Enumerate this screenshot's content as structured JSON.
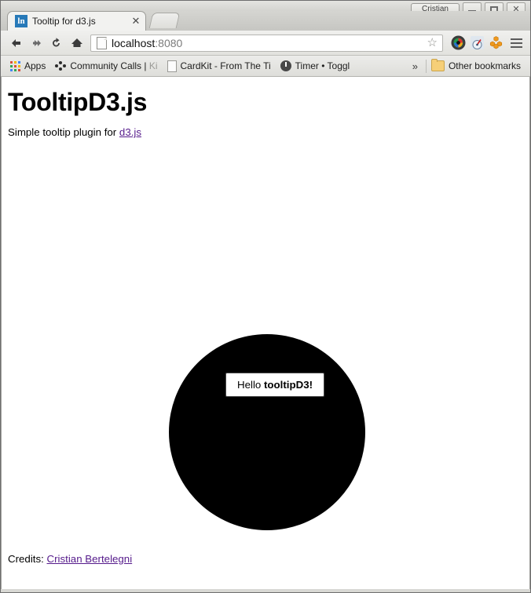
{
  "window": {
    "profile_label": "Cristian",
    "minimize_label": "–",
    "maximize_label": "□",
    "close_label": "✕"
  },
  "tabs": [
    {
      "favicon_text": "ln",
      "title": "Tooltip for d3.js",
      "close_label": "✕"
    }
  ],
  "newtab": {
    "label": ""
  },
  "toolbar": {
    "back_label": "⬅",
    "forward_label": "➡",
    "reload_label": "↺",
    "home_label": "⌂",
    "url_host": "localhost",
    "url_port": ":8080",
    "url_full": "localhost:8080",
    "star_label": "☆",
    "menu_label": "☰"
  },
  "bookmarks": {
    "apps_label": "Apps",
    "items": [
      {
        "label": "Community Calls | ",
        "suffix": "Ki",
        "icon": "dots-icon"
      },
      {
        "label": "CardKit - From The Ti",
        "suffix": "",
        "icon": "document-icon"
      },
      {
        "label": "Timer • Toggl",
        "suffix": "",
        "icon": "toggl-icon"
      }
    ],
    "overflow_label": "»",
    "other_label": "Other bookmarks"
  },
  "page": {
    "heading": "TooltipD3.js",
    "intro_prefix": "Simple tooltip plugin for ",
    "intro_link": "d3.js",
    "tooltip_prefix": "Hello ",
    "tooltip_strong": "tooltipD3!",
    "credits_prefix": "Credits: ",
    "credits_link": "Cristian Bertelegni",
    "circle_color": "#000000",
    "link_color": "#551a8b"
  }
}
